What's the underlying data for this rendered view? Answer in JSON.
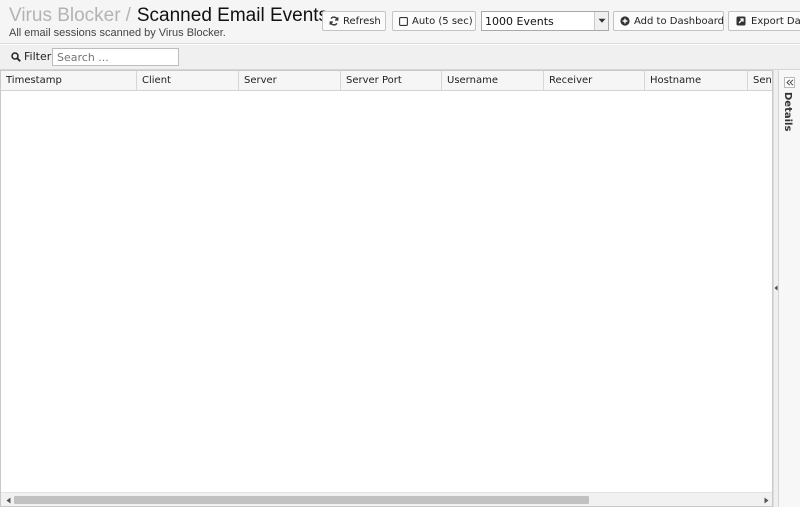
{
  "header": {
    "breadcrumb_parent": "Virus Blocker",
    "breadcrumb_separator": "/",
    "title": "Scanned Email Events",
    "subtitle": "All email sessions scanned by Virus Blocker."
  },
  "toolbar": {
    "refresh_label": "Refresh",
    "refresh_icon": "refresh-icon",
    "auto_label": "Auto (5 sec)",
    "auto_checked": false,
    "events_select_value": "1000 Events",
    "add_dashboard_label": "Add to Dashboard",
    "add_dashboard_icon": "plus-circle-icon",
    "export_label": "Export Da",
    "export_icon": "export-icon"
  },
  "filter": {
    "label": "Filter",
    "placeholder": "Search ..."
  },
  "grid": {
    "columns": [
      "Timestamp",
      "Client",
      "Server",
      "Server Port",
      "Username",
      "Receiver",
      "Hostname",
      "Sender"
    ],
    "rows": []
  },
  "details_panel": {
    "label": "Details"
  }
}
